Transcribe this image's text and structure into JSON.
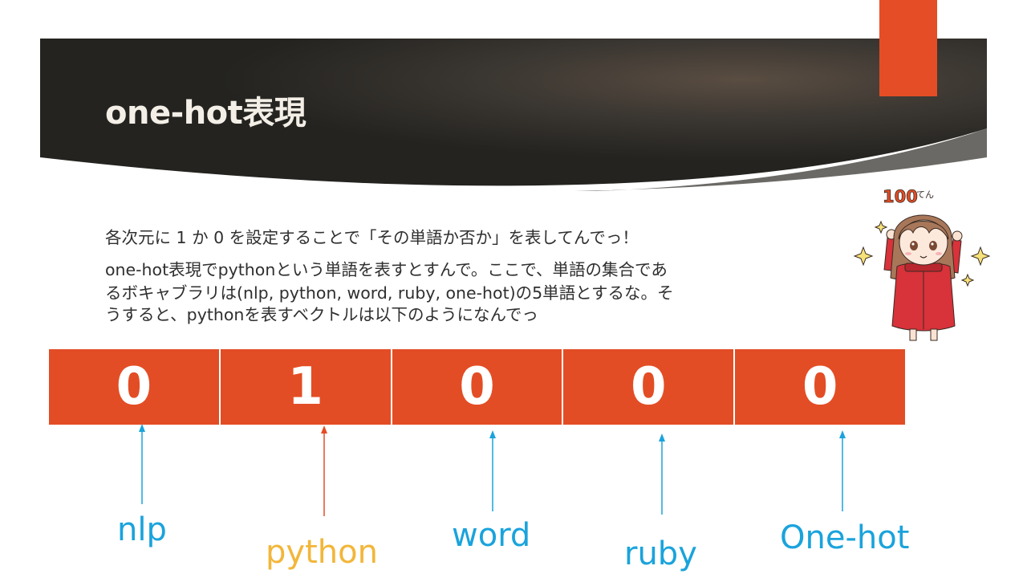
{
  "slide": {
    "title": "one-hot表現",
    "lines": [
      "各次元に 1 か 0 を設定することで「その単語か否か」を表してんでっ！",
      "one-hot表現でpythonという単語を表すとすんで。ここで、単語の集合であ",
      "るボキャブラリは(nlp, python, word, ruby, one-hot)の5単語とするな。そ",
      "うすると、pythonを表すベクトルは以下のようになんでっ"
    ]
  },
  "vector": {
    "values": [
      "0",
      "1",
      "0",
      "0",
      "0"
    ]
  },
  "labels": [
    {
      "text": "nlp",
      "color": "#1aa3dc"
    },
    {
      "text": "python",
      "color": "#f2b63a"
    },
    {
      "text": "word",
      "color": "#1aa3dc"
    },
    {
      "text": "ruby",
      "color": "#1aa3dc"
    },
    {
      "text": "One-hot",
      "color": "#1aa3dc"
    }
  ],
  "mascot": {
    "badge": "100",
    "badge_suffix": "てん"
  },
  "colors": {
    "accent": "#e34d25",
    "banner_dark": "#2b2a27",
    "label_blue": "#1aa3dc",
    "label_yellow": "#f2b63a",
    "arrow_red": "#e34d25"
  }
}
